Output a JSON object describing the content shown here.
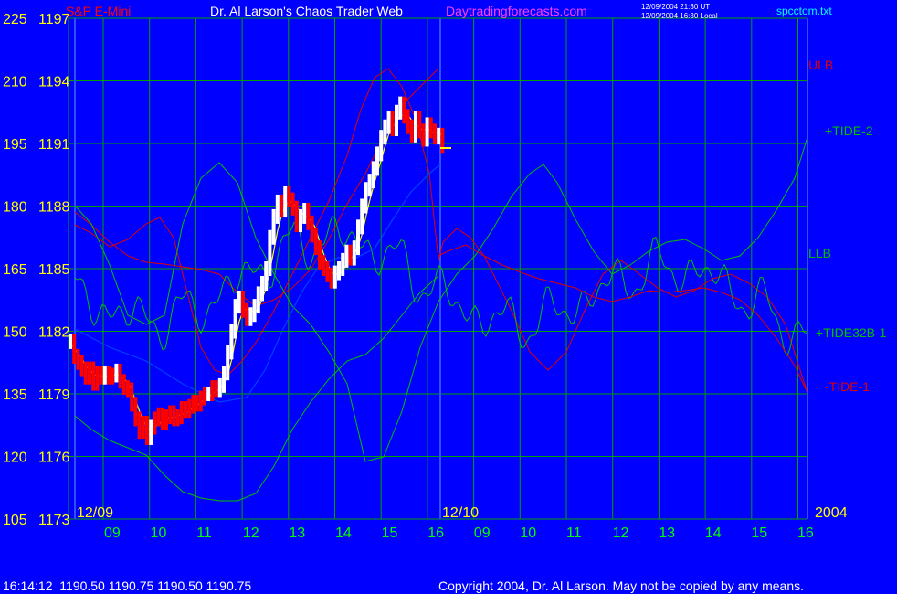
{
  "header": {
    "symbol": "S&P E-Mini",
    "title": "Dr. Al Larson's Chaos Trader Web",
    "site": "Daytradingforecasts.com",
    "stamp_ut": "12/09/2004 21:30 UT",
    "stamp_local": "12/09/2004 16:30 Local",
    "file": "spcctom.txt"
  },
  "footer": {
    "quote": "16:14:12  1190.50 1190.75 1190.50 1190.75",
    "copyright": "Copyright 2004, Dr. Al Larson. May not be copied by any means."
  },
  "colors": {
    "background": "#0000ff",
    "grid": "#00a000",
    "price_up": "#ffffff",
    "price_down": "#ff0000",
    "avg_fast": "#ffff00",
    "avg_slow": "#0040ff",
    "tide_green": "#00c000",
    "tide_red": "#e00000",
    "day_divider": "#0000ff",
    "axis_text": "#ffff00",
    "hour_text": "#00ff00"
  },
  "chart_data": {
    "type": "line",
    "x_unit": "hour of day (two sessions: 12/09 and 12/10, 2004)",
    "x_labels": [
      "09",
      "10",
      "11",
      "12",
      "13",
      "14",
      "15",
      "16",
      "09",
      "10",
      "11",
      "12",
      "13",
      "14",
      "15",
      "16"
    ],
    "date_labels": [
      "12/09",
      "12/10",
      "2004"
    ],
    "y_axis_left": {
      "oscillator_values": [
        225,
        210,
        195,
        180,
        165,
        150,
        135,
        120,
        105
      ],
      "price_values": [
        1197,
        1194,
        1191,
        1188,
        1185,
        1182,
        1179,
        1176,
        1173
      ],
      "ylim_price": [
        1173,
        1197
      ]
    },
    "grid": true,
    "series_labels": [
      "ULB",
      "+TIDE-2",
      "LLB",
      "+TIDE32B-1",
      "-TIDE-1"
    ],
    "price_points": [
      [
        0.0,
        1181.5
      ],
      [
        0.1,
        1180.8
      ],
      [
        0.2,
        1180.5
      ],
      [
        0.3,
        1180.2
      ],
      [
        0.4,
        1179.8
      ],
      [
        0.5,
        1180.2
      ],
      [
        0.6,
        1179.5
      ],
      [
        0.7,
        1180.0
      ],
      [
        0.8,
        1179.8
      ],
      [
        0.9,
        1180.0
      ],
      [
        1.0,
        1179.8
      ],
      [
        1.1,
        1179.9
      ],
      [
        1.2,
        1180.1
      ],
      [
        1.3,
        1179.6
      ],
      [
        1.4,
        1179.3
      ],
      [
        1.5,
        1179.2
      ],
      [
        1.6,
        1178.5
      ],
      [
        1.7,
        1177.8
      ],
      [
        1.8,
        1177.2
      ],
      [
        1.9,
        1177.6
      ],
      [
        2.0,
        1176.9
      ],
      [
        2.1,
        1177.4
      ],
      [
        2.2,
        1177.8
      ],
      [
        2.3,
        1178.0
      ],
      [
        2.4,
        1177.6
      ],
      [
        2.5,
        1177.9
      ],
      [
        2.6,
        1178.1
      ],
      [
        2.7,
        1177.8
      ],
      [
        2.8,
        1177.9
      ],
      [
        2.9,
        1178.3
      ],
      [
        3.0,
        1178.2
      ],
      [
        3.1,
        1178.4
      ],
      [
        3.2,
        1178.6
      ],
      [
        3.3,
        1178.5
      ],
      [
        3.4,
        1178.8
      ],
      [
        3.5,
        1179.0
      ],
      [
        3.6,
        1179.0
      ],
      [
        3.7,
        1179.3
      ],
      [
        3.8,
        1179.2
      ],
      [
        3.9,
        1179.4
      ],
      [
        4.0,
        1180.0
      ],
      [
        4.1,
        1181.0
      ],
      [
        4.2,
        1182.0
      ],
      [
        4.3,
        1183.2
      ],
      [
        4.4,
        1183.6
      ],
      [
        4.5,
        1183.0
      ],
      [
        4.6,
        1182.6
      ],
      [
        4.7,
        1182.8
      ],
      [
        4.8,
        1183.2
      ],
      [
        4.9,
        1183.8
      ],
      [
        5.0,
        1184.3
      ],
      [
        5.1,
        1185.0
      ],
      [
        5.2,
        1186.5
      ],
      [
        5.3,
        1187.5
      ],
      [
        5.4,
        1188.2
      ],
      [
        5.5,
        1187.8
      ],
      [
        5.6,
        1188.6
      ],
      [
        5.7,
        1188.3
      ],
      [
        5.8,
        1187.9
      ],
      [
        5.9,
        1187.1
      ],
      [
        6.0,
        1187.5
      ],
      [
        6.1,
        1187.8
      ],
      [
        6.2,
        1187.2
      ],
      [
        6.3,
        1186.6
      ],
      [
        6.4,
        1186.0
      ],
      [
        6.5,
        1185.3
      ],
      [
        6.6,
        1185.0
      ],
      [
        6.7,
        1184.7
      ],
      [
        6.8,
        1184.4
      ],
      [
        6.9,
        1184.8
      ],
      [
        7.0,
        1185.0
      ],
      [
        7.1,
        1185.4
      ],
      [
        7.2,
        1185.8
      ],
      [
        7.3,
        1185.5
      ],
      [
        7.4,
        1186.0
      ],
      [
        7.5,
        1187.0
      ],
      [
        7.6,
        1188.0
      ],
      [
        7.7,
        1188.8
      ],
      [
        7.8,
        1189.2
      ],
      [
        7.9,
        1189.8
      ],
      [
        8.0,
        1190.5
      ],
      [
        8.1,
        1191.3
      ],
      [
        8.2,
        1191.8
      ],
      [
        8.3,
        1192.2
      ],
      [
        8.4,
        1191.7
      ],
      [
        8.5,
        1192.5
      ],
      [
        8.6,
        1192.9
      ],
      [
        8.7,
        1192.3
      ],
      [
        8.8,
        1191.8
      ],
      [
        8.9,
        1191.4
      ],
      [
        9.0,
        1192.2
      ],
      [
        9.1,
        1191.6
      ],
      [
        9.2,
        1191.2
      ],
      [
        9.3,
        1191.9
      ],
      [
        9.4,
        1191.6
      ],
      [
        9.5,
        1191.3
      ],
      [
        9.6,
        1191.4
      ],
      [
        9.7,
        1190.9
      ]
    ],
    "last_price": 1190.75
  }
}
